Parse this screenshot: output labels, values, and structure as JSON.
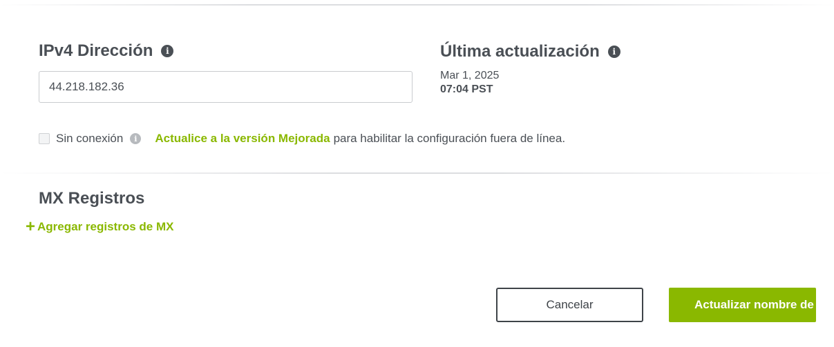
{
  "ipv4": {
    "title": "IPv4 Dirección",
    "value": "44.218.182.36"
  },
  "last_updated": {
    "title": "Última actualización",
    "date": "Mar 1, 2025",
    "time": "07:04 PST"
  },
  "offline": {
    "label": "Sin conexión",
    "checked": false,
    "upgrade_link": "Actualice a la versión Mejorada",
    "upgrade_text": "para habilitar la configuración fuera de línea."
  },
  "mx": {
    "title": "MX Registros",
    "add_label": "Agregar registros de MX"
  },
  "buttons": {
    "cancel": "Cancelar",
    "update": "Actualizar nombre de"
  },
  "colors": {
    "accent": "#8ab800",
    "text": "#4a4f55"
  },
  "icons": {
    "info": "info-icon",
    "plus": "plus-icon"
  }
}
